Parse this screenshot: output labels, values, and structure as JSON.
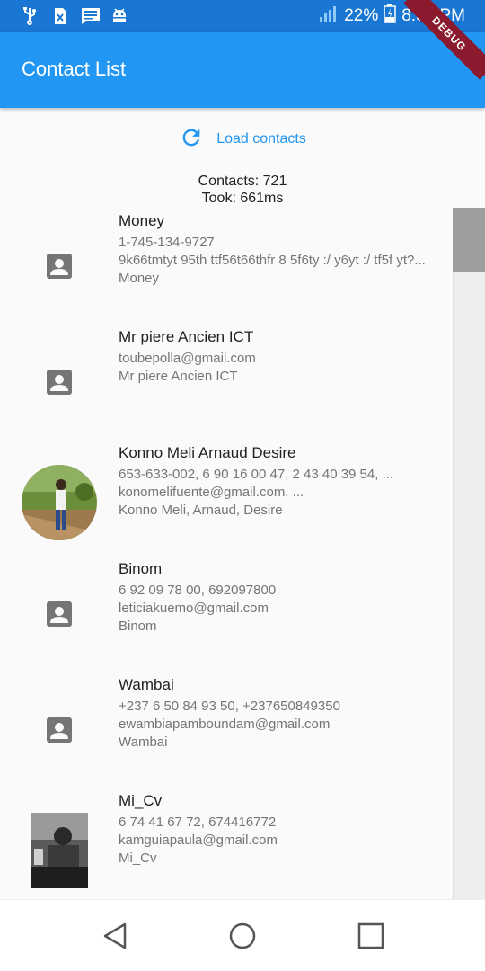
{
  "status_bar": {
    "battery_percent": "22%",
    "time": "8:51 PM",
    "icons": [
      "usb-icon",
      "no-sim-icon",
      "message-icon",
      "android-debug-icon",
      "signal-icon",
      "battery-icon"
    ]
  },
  "debug_banner": "DEBUG",
  "app_bar": {
    "title": "Contact List"
  },
  "load_button": {
    "label": "Load contacts",
    "icon": "refresh-icon"
  },
  "stats": {
    "contacts": "Contacts: 721",
    "took": "Took: 661ms"
  },
  "contacts": [
    {
      "name": "Money",
      "lines": [
        "1-745-134-9727",
        "9k66tmtyt 95th ttf56t66thfr 8 5f6ty :/ y6yt :/ tf5f yt?...",
        "Money"
      ],
      "avatar": "person-placeholder"
    },
    {
      "name": "Mr piere Ancien ICT",
      "lines": [
        "toubepolla@gmail.com",
        "Mr piere Ancien ICT"
      ],
      "avatar": "person-placeholder"
    },
    {
      "name": "Konno Meli Arnaud Desire",
      "lines": [
        "653-633-002, 6 90 16 00 47, 2 43 40 39 54, ...",
        "konomelifuente@gmail.com, ...",
        "Konno Meli, Arnaud, Desire"
      ],
      "avatar": "photo"
    },
    {
      "name": "Binom",
      "lines": [
        "6 92 09 78 00, 692097800",
        "leticiakuemo@gmail.com",
        "Binom"
      ],
      "avatar": "person-placeholder"
    },
    {
      "name": "Wambai",
      "lines": [
        "+237 6 50 84 93 50, +237650849350",
        "ewambiapamboundam@gmail.com",
        "Wambai"
      ],
      "avatar": "person-placeholder"
    },
    {
      "name": "Mi_Cv",
      "lines": [
        "6 74 41 67 72, 674416772",
        "kamguiapaula@gmail.com",
        "Mi_Cv"
      ],
      "avatar": "photo"
    }
  ],
  "colors": {
    "status_bar": "#1976d2",
    "app_bar": "#2196f3",
    "accent": "#2196f3",
    "background": "#fafafa"
  },
  "nav_bar": {
    "buttons": [
      "back-icon",
      "home-icon",
      "recents-icon"
    ]
  }
}
